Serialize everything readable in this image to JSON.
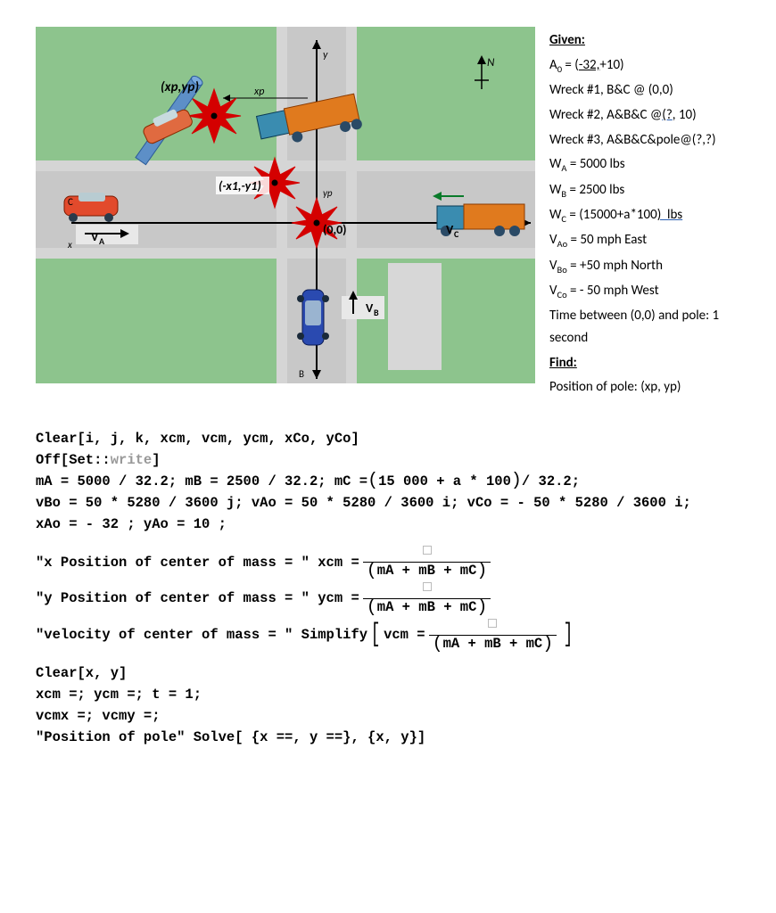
{
  "given": {
    "header": "Given:",
    "a0": "A₀ = (-32,+10)",
    "w1": "Wreck #1, B&C @ (0,0)",
    "w2": "Wreck #2, A&B&C @(?, 10)",
    "w3": "Wreck #3, A&B&C&pole@(?,?)",
    "wa": "Wᴀ = 5000 lbs",
    "wb": "Wʙ = 2500 lbs",
    "wc": "W꜀ = (15000+a*100)  lbs",
    "vao": "Vᴀₒ = 50 mph East",
    "vbo": "Vʙₒ = +50 mph North",
    "vco": "V꜀ₒ = - 50 mph West",
    "time": "Time between (0,0) and pole: 1 second"
  },
  "find": {
    "header": "Find:",
    "line": "Position of pole: (xp, yp)"
  },
  "diagram": {
    "xp_yp": "(xp,yp)",
    "x1_y1": "(-x1,-y1)",
    "origin": "(0,0)",
    "va": "Vᴀ",
    "vb": "Vʙ",
    "vc": "V꜀"
  },
  "code": {
    "l1": "Clear[i, j, k, xcm, vcm, ycm, xCo, yCo]",
    "l2a": "Off[Set::",
    "l2b": "write",
    "l2c": "]",
    "l3a": "mA = 5000 / 32.2;  mB = 2500 / 32.2;  mC = ",
    "l3b": "15 000 + a * 100",
    "l3c": " / 32.2;",
    "l4": "vBo = 50 * 5280 / 3600 j;  vAo = 50 * 5280 / 3600 i; vCo = - 50 * 5280 / 3600 i;",
    "l5": "xAo = - 32 ; yAo = 10 ;",
    "l6a": "\"x Position of center of mass = \" xcm = ",
    "den": "mA + mB + mC",
    "l7a": "\"y Position of center of mass = \" ycm = ",
    "l8a": "\"velocity of center of mass = \" Simplify",
    "l8b": " vcm = ",
    "l9": "Clear[x, y]",
    "l10": "xcm =;  ycm =; t = 1;",
    "l11": "vcmx =;  vcmy =;",
    "l12": "\"Position of pole\" Solve[ {x ==, y ==}, {x, y}]"
  }
}
